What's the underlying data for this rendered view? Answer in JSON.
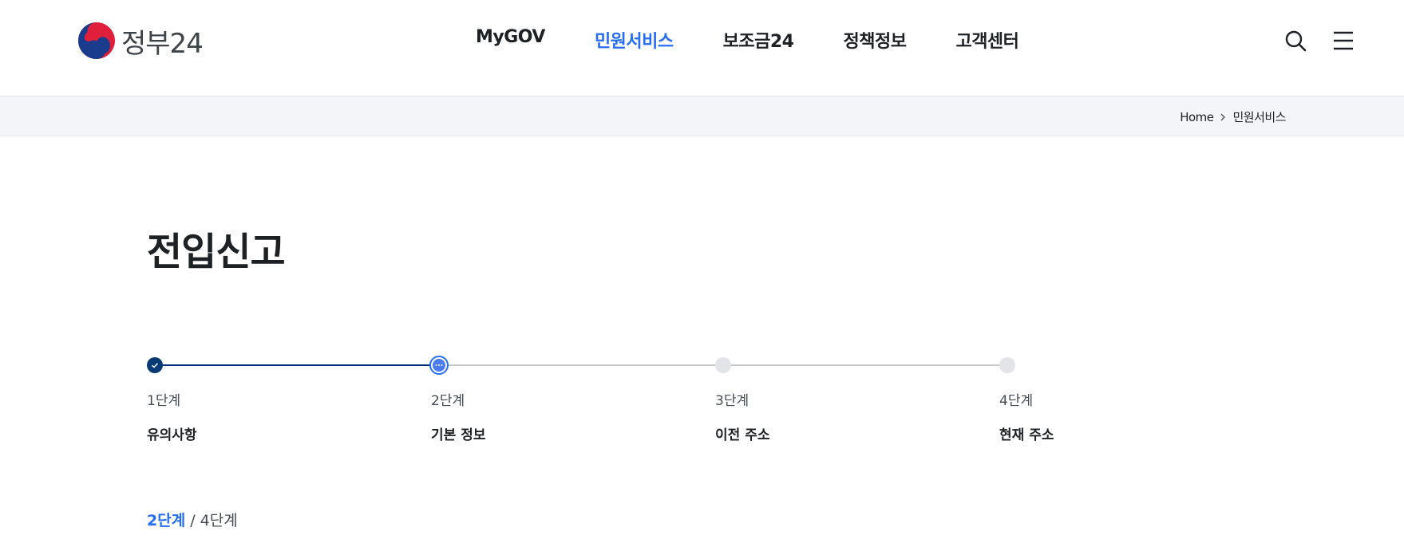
{
  "header": {
    "logo_text": "정부24",
    "nav": [
      {
        "label": "MyGOV",
        "active": false
      },
      {
        "label": "민원서비스",
        "active": true
      },
      {
        "label": "보조금24",
        "active": false
      },
      {
        "label": "정책정보",
        "active": false
      },
      {
        "label": "고객센터",
        "active": false
      }
    ],
    "icons": [
      "search-icon",
      "menu-icon"
    ]
  },
  "breadcrumb": {
    "home": "Home",
    "current": "민원서비스"
  },
  "page": {
    "title": "전입신고"
  },
  "stepper": {
    "steps": [
      {
        "number": "1단계",
        "label": "유의사항",
        "state": "done"
      },
      {
        "number": "2단계",
        "label": "기본 정보",
        "state": "current"
      },
      {
        "number": "3단계",
        "label": "이전 주소",
        "state": "todo"
      },
      {
        "number": "4단계",
        "label": "현재 주소",
        "state": "todo"
      }
    ]
  },
  "counter": {
    "current": "2단계",
    "separator": " / ",
    "total": "4단계"
  },
  "colors": {
    "accent": "#256ef4",
    "done": "#063a74",
    "todo": "#e3e4e8"
  }
}
